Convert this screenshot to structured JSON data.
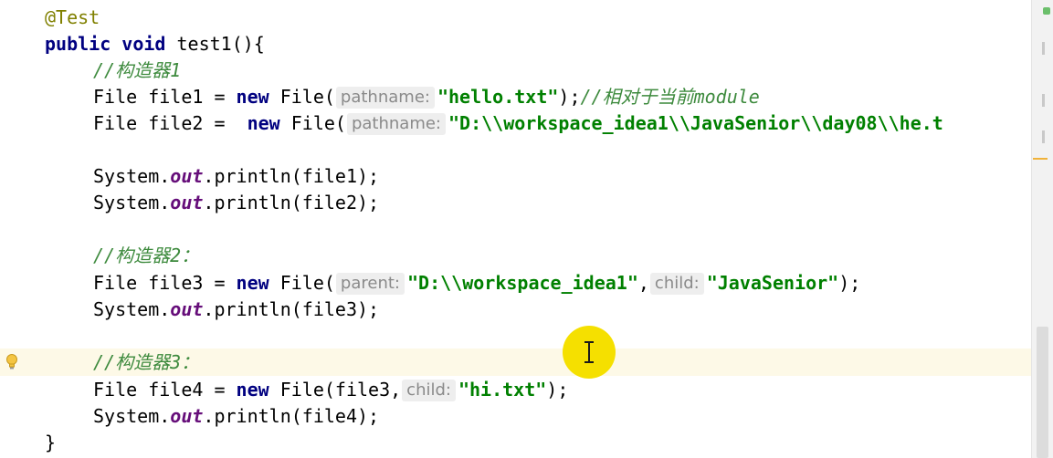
{
  "editor": {
    "lines": {
      "l1": {
        "annotation": "@Test"
      },
      "l2": {
        "public": "public",
        "void": "void",
        "rest": " test1(){"
      },
      "l3": {
        "comment": "//构造器1"
      },
      "l4": {
        "decl": "File file1 = ",
        "new": "new",
        "call": " File(",
        "hint": "pathname:",
        "str": "\"hello.txt\"",
        "close": ");",
        "comment": "//相对于当前module"
      },
      "l5": {
        "decl": "File file2 =  ",
        "new": "new",
        "call": " File(",
        "hint": "pathname:",
        "str": "\"D:\\\\workspace_idea1\\\\JavaSenior\\\\day08\\\\he.t"
      },
      "l7": {
        "prefix": "System.",
        "field": "out",
        "call": ".println(file1);"
      },
      "l8": {
        "prefix": "System.",
        "field": "out",
        "call": ".println(file2);"
      },
      "l10": {
        "comment": "//构造器2："
      },
      "l11": {
        "decl": "File file3 = ",
        "new": "new",
        "call": " File(",
        "hint1": "parent:",
        "str1": "\"D:\\\\workspace_idea1\"",
        "comma": ",",
        "hint2": "child:",
        "str2": "\"JavaSenior\"",
        "close": ");"
      },
      "l12": {
        "prefix": "System.",
        "field": "out",
        "call": ".println(file3);"
      },
      "l14": {
        "comment": "//构造器3："
      },
      "l15": {
        "decl": "File file4 = ",
        "new": "new",
        "call": " File(file3,",
        "hint": "child:",
        "str": "\"hi.txt\"",
        "close": ");"
      },
      "l16": {
        "prefix": "System.",
        "field": "out",
        "call": ".println(file4);"
      },
      "l17": {
        "brace": "}"
      }
    }
  },
  "icons": {
    "gutter": "lightbulb-icon",
    "cursor": "text-cursor-icon"
  },
  "colors": {
    "keyword": "#000080",
    "string": "#008000",
    "comment": "#808080",
    "annotation": "#808000",
    "static_field": "#660e7a",
    "current_line": "#fdf9e7",
    "cursor_highlight": "#f5e000"
  }
}
